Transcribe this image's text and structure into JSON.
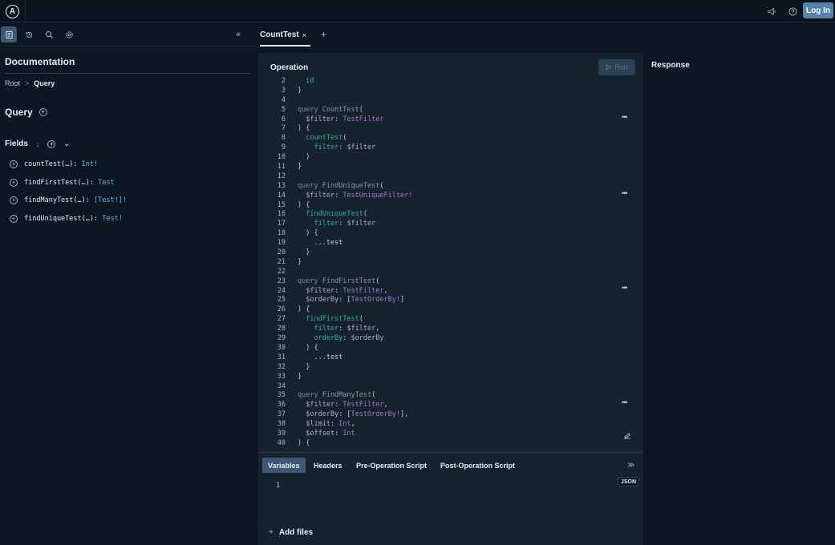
{
  "topbar": {
    "logo_letter": "A",
    "announce_icon": "megaphone-icon",
    "help_icon": "help-circle-icon",
    "login_label": "Log In"
  },
  "left": {
    "toolbar_icons": [
      "documentation-icon",
      "history-icon",
      "search-icon",
      "settings-icon"
    ],
    "collapse_glyph": "«",
    "doc_title": "Documentation",
    "breadcrumb": {
      "root": "Root",
      "sep": ">",
      "current": "Query"
    },
    "query_heading": "Query",
    "fields_heading": "Fields",
    "fields": [
      {
        "name": "countTest(…):",
        "type": "Int!"
      },
      {
        "name": "findFirstTest(…):",
        "type": "Test"
      },
      {
        "name": "findManyTest(…):",
        "type": "[Test!]!"
      },
      {
        "name": "findUniqueTest(…):",
        "type": "Test!"
      }
    ]
  },
  "tabs": {
    "active": "CountTest",
    "close": "×",
    "add": "+"
  },
  "operation": {
    "title": "Operation",
    "run_label": "Run",
    "lines": [
      {
        "n": "2",
        "segs": [
          [
            "a",
            "  id"
          ]
        ]
      },
      {
        "n": "3",
        "segs": [
          [
            "p",
            "}"
          ]
        ]
      },
      {
        "n": "4",
        "segs": []
      },
      {
        "n": "5",
        "segs": [
          [
            "k",
            "query "
          ],
          [
            "n",
            "CountTest"
          ],
          [
            "p",
            "("
          ]
        ]
      },
      {
        "n": "6",
        "segs": [
          [
            "v",
            "  $filter"
          ],
          [
            "p",
            ": "
          ],
          [
            "t",
            "TestFilter"
          ]
        ]
      },
      {
        "n": "7",
        "segs": [
          [
            "p",
            ") {"
          ]
        ]
      },
      {
        "n": "8",
        "segs": [
          [
            "f",
            "  countTest"
          ],
          [
            "p",
            "("
          ]
        ]
      },
      {
        "n": "9",
        "segs": [
          [
            "a",
            "    filter"
          ],
          [
            "p",
            ": "
          ],
          [
            "v",
            "$filter"
          ]
        ]
      },
      {
        "n": "10",
        "segs": [
          [
            "p",
            "  )"
          ]
        ]
      },
      {
        "n": "11",
        "segs": [
          [
            "p",
            "}"
          ]
        ]
      },
      {
        "n": "12",
        "segs": []
      },
      {
        "n": "13",
        "segs": [
          [
            "k",
            "query "
          ],
          [
            "n",
            "FindUniqueTest"
          ],
          [
            "p",
            "("
          ]
        ]
      },
      {
        "n": "14",
        "segs": [
          [
            "v",
            "  $filter"
          ],
          [
            "p",
            ": "
          ],
          [
            "t",
            "TestUniqueFilter!"
          ]
        ]
      },
      {
        "n": "15",
        "segs": [
          [
            "p",
            ") {"
          ]
        ]
      },
      {
        "n": "16",
        "segs": [
          [
            "f",
            "  findUniqueTest"
          ],
          [
            "p",
            "("
          ]
        ]
      },
      {
        "n": "17",
        "segs": [
          [
            "a",
            "    filter"
          ],
          [
            "p",
            ": "
          ],
          [
            "v",
            "$filter"
          ]
        ]
      },
      {
        "n": "18",
        "segs": [
          [
            "p",
            "  ) {"
          ]
        ]
      },
      {
        "n": "19",
        "segs": [
          [
            "p",
            "    ...test"
          ]
        ]
      },
      {
        "n": "20",
        "segs": [
          [
            "p",
            "  }"
          ]
        ]
      },
      {
        "n": "21",
        "segs": [
          [
            "p",
            "}"
          ]
        ]
      },
      {
        "n": "22",
        "segs": []
      },
      {
        "n": "23",
        "segs": [
          [
            "k",
            "query "
          ],
          [
            "n",
            "FindFirstTest"
          ],
          [
            "p",
            "("
          ]
        ]
      },
      {
        "n": "24",
        "segs": [
          [
            "v",
            "  $filter"
          ],
          [
            "p",
            ": "
          ],
          [
            "t",
            "TestFilter"
          ],
          [
            "p",
            ","
          ]
        ]
      },
      {
        "n": "25",
        "segs": [
          [
            "v",
            "  $orderBy"
          ],
          [
            "p",
            ": ["
          ],
          [
            "t",
            "TestOrderBy!"
          ],
          [
            "p",
            "]"
          ]
        ]
      },
      {
        "n": "26",
        "segs": [
          [
            "p",
            ") {"
          ]
        ]
      },
      {
        "n": "27",
        "segs": [
          [
            "f",
            "  findFirstTest"
          ],
          [
            "p",
            "("
          ]
        ]
      },
      {
        "n": "28",
        "segs": [
          [
            "a",
            "    filter"
          ],
          [
            "p",
            ": "
          ],
          [
            "v",
            "$filter"
          ],
          [
            "p",
            ","
          ]
        ]
      },
      {
        "n": "29",
        "segs": [
          [
            "a",
            "    orderBy"
          ],
          [
            "p",
            ": "
          ],
          [
            "v",
            "$orderBy"
          ]
        ]
      },
      {
        "n": "30",
        "segs": [
          [
            "p",
            "  ) {"
          ]
        ]
      },
      {
        "n": "31",
        "segs": [
          [
            "p",
            "    ...test"
          ]
        ]
      },
      {
        "n": "32",
        "segs": [
          [
            "p",
            "  }"
          ]
        ]
      },
      {
        "n": "33",
        "segs": [
          [
            "p",
            "}"
          ]
        ]
      },
      {
        "n": "34",
        "segs": []
      },
      {
        "n": "35",
        "segs": [
          [
            "k",
            "query "
          ],
          [
            "n",
            "FindManyTest"
          ],
          [
            "p",
            "("
          ]
        ]
      },
      {
        "n": "36",
        "segs": [
          [
            "v",
            "  $filter"
          ],
          [
            "p",
            ": "
          ],
          [
            "t",
            "TestFilter"
          ],
          [
            "p",
            ","
          ]
        ]
      },
      {
        "n": "37",
        "segs": [
          [
            "v",
            "  $orderBy"
          ],
          [
            "p",
            ": ["
          ],
          [
            "t",
            "TestOrderBy!"
          ],
          [
            "p",
            "],"
          ]
        ]
      },
      {
        "n": "38",
        "segs": [
          [
            "v",
            "  $limit"
          ],
          [
            "p",
            ": "
          ],
          [
            "t",
            "Int"
          ],
          [
            "p",
            ","
          ]
        ]
      },
      {
        "n": "39",
        "segs": [
          [
            "v",
            "  $offset"
          ],
          [
            "p",
            ": "
          ],
          [
            "t",
            "Int"
          ]
        ]
      },
      {
        "n": "40",
        "segs": [
          [
            "p",
            ") {"
          ]
        ]
      }
    ],
    "menu_glyph": "•••",
    "prettify_icon": "prettify-icon"
  },
  "bottom": {
    "tabs": [
      "Variables",
      "Headers",
      "Pre-Operation Script",
      "Post-Operation Script"
    ],
    "active_tab": "Variables",
    "collapse_glyph": "≫",
    "json_badge": "JSON",
    "var_line_number": "1",
    "add_files_label": "Add files",
    "add_glyph": "+"
  },
  "response": {
    "title": "Response"
  },
  "colors": {
    "accent": "#5783ab",
    "panel": "#16232f",
    "bg": "#0d1722",
    "active_tab": "#3c5872"
  }
}
